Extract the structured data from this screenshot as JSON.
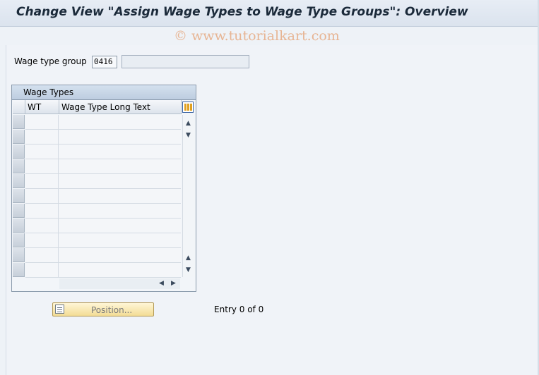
{
  "window": {
    "title": "Change View \"Assign Wage Types to Wage Type Groups\": Overview",
    "watermark": "© www.tutorialkart.com"
  },
  "form": {
    "wage_type_group_label": "Wage type group",
    "wage_type_group_value": "0416",
    "wage_type_group_description": ""
  },
  "table": {
    "caption": "Wage Types",
    "columns": [
      "WT",
      "Wage Type Long Text"
    ],
    "rows": [
      {
        "wt": "",
        "text": ""
      },
      {
        "wt": "",
        "text": ""
      },
      {
        "wt": "",
        "text": ""
      },
      {
        "wt": "",
        "text": ""
      },
      {
        "wt": "",
        "text": ""
      },
      {
        "wt": "",
        "text": ""
      },
      {
        "wt": "",
        "text": ""
      },
      {
        "wt": "",
        "text": ""
      },
      {
        "wt": "",
        "text": ""
      },
      {
        "wt": "",
        "text": ""
      },
      {
        "wt": "",
        "text": ""
      }
    ],
    "icons": {
      "settings": "table-settings-icon",
      "scroll_up": "scroll-up-icon",
      "scroll_down": "scroll-down-icon",
      "scroll_left": "scroll-left-icon",
      "scroll_right": "scroll-right-icon"
    }
  },
  "footer": {
    "position_button_label": "Position...",
    "position_icon": "position-icon",
    "entry_text": "Entry 0 of 0"
  }
}
